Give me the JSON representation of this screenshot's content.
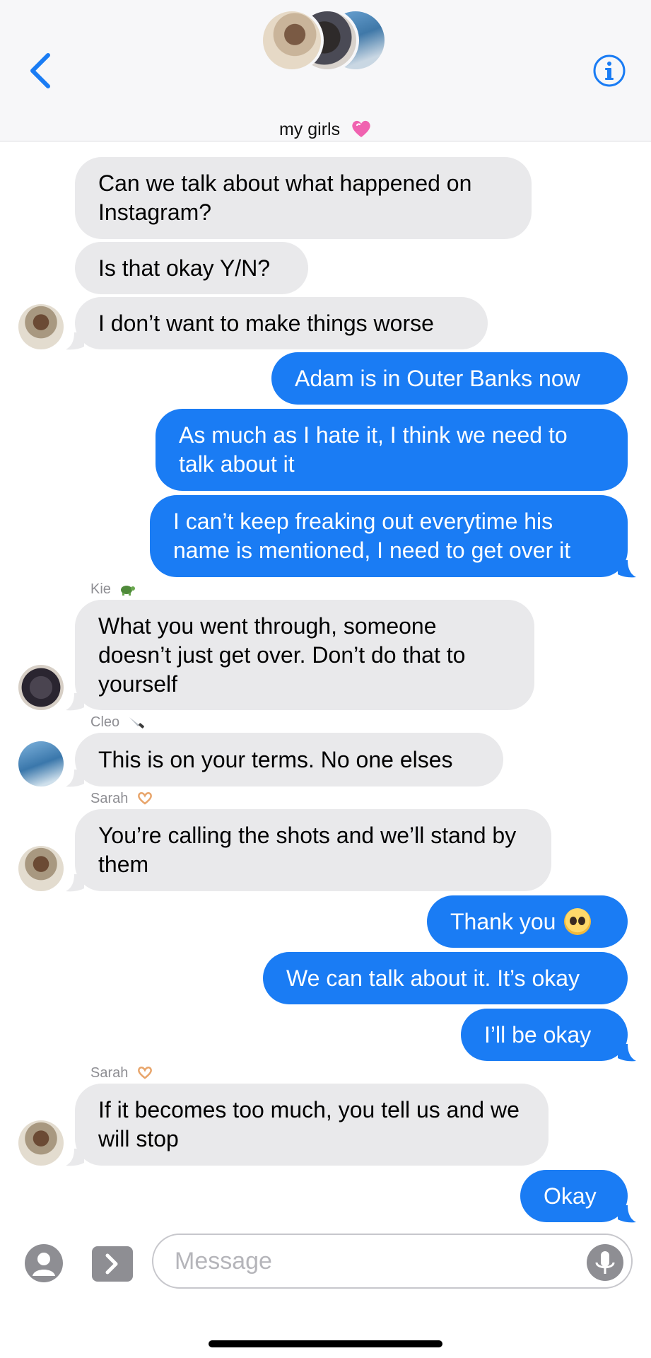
{
  "header": {
    "back_icon": "chevron-left-icon",
    "info_icon": "info-icon",
    "group_name": "my girls",
    "accent": "#1a7cf4"
  },
  "messages": [
    {
      "id": "m1",
      "side": "received",
      "text": "Can we talk about what happened on Instagram?"
    },
    {
      "id": "m2",
      "side": "received",
      "text": "Is that okay Y/N?"
    },
    {
      "id": "m3",
      "side": "received",
      "text": "I don’t want to make things worse"
    },
    {
      "id": "m4",
      "side": "sent",
      "text": "Adam is in Outer Banks now"
    },
    {
      "id": "m5",
      "side": "sent",
      "text": "As much as I hate it, I think we need to talk about it"
    },
    {
      "id": "m6",
      "side": "sent",
      "text": "I can’t keep freaking out everytime his name is mentioned, I need to get over it"
    },
    {
      "id": "m7",
      "side": "received",
      "sender": "Kie",
      "text": "What you went through, someone doesn’t just get over. Don’t do that to yourself"
    },
    {
      "id": "m8",
      "side": "received",
      "sender": "Cleo",
      "text": "This is on your terms. No one elses"
    },
    {
      "id": "m9",
      "side": "received",
      "sender": "Sarah",
      "text": "You’re calling the shots and we’ll stand by them"
    },
    {
      "id": "m10",
      "side": "sent",
      "text": "Thank you"
    },
    {
      "id": "m11",
      "side": "sent",
      "text": "We can talk about it. It’s okay"
    },
    {
      "id": "m12",
      "side": "sent",
      "text": "I’ll be okay"
    },
    {
      "id": "m13",
      "side": "received",
      "sender": "Sarah",
      "text": "If it becomes too much, you tell us and we will stop"
    },
    {
      "id": "m14",
      "side": "sent",
      "text": "Okay"
    }
  ],
  "senders": {
    "kie": "Kie",
    "cleo": "Cleo",
    "sarah": "Sarah"
  },
  "composer": {
    "placeholder": "Message",
    "camera_icon": "camera-icon",
    "apps_icon": "chevron-right-icon",
    "mic_icon": "microphone-icon"
  },
  "colors": {
    "sent_bubble": "#1a7cf4",
    "received_bubble": "#e9e9eb"
  }
}
